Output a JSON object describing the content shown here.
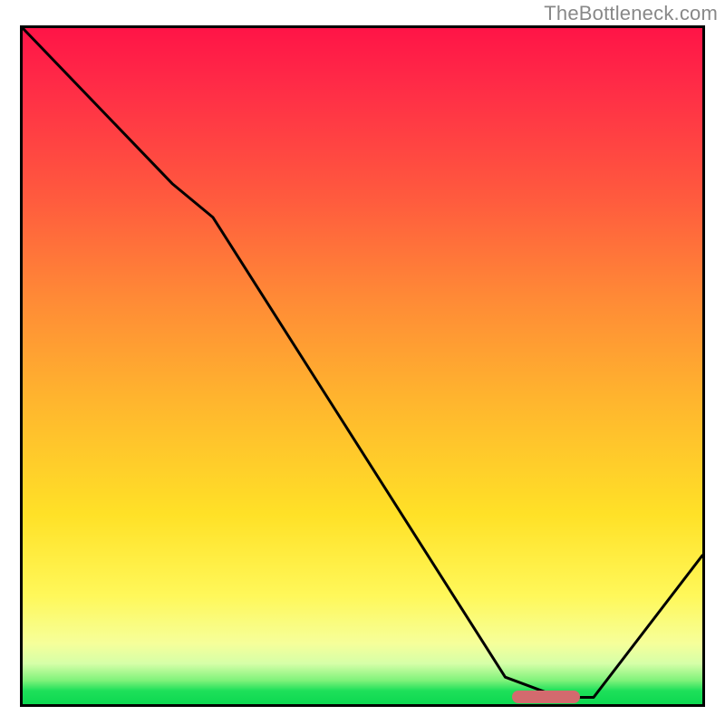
{
  "watermark": "TheBottleneck.com",
  "chart_data": {
    "type": "line",
    "title": "",
    "xlabel": "",
    "ylabel": "",
    "xlim": [
      0,
      100
    ],
    "ylim": [
      0,
      100
    ],
    "grid": false,
    "legend": false,
    "x_pct": [
      0,
      22,
      28,
      71,
      79,
      84,
      100
    ],
    "y_pct": [
      100,
      77,
      72,
      4,
      1,
      1,
      22
    ],
    "minimum_marker": {
      "x_start_pct": 72,
      "x_end_pct": 82,
      "y_pct": 1
    },
    "gradient_stops": [
      {
        "pct": 0,
        "color": "#ff1447"
      },
      {
        "pct": 8,
        "color": "#ff2a47"
      },
      {
        "pct": 25,
        "color": "#ff5a3e"
      },
      {
        "pct": 40,
        "color": "#ff8a36"
      },
      {
        "pct": 55,
        "color": "#ffb52e"
      },
      {
        "pct": 72,
        "color": "#ffe127"
      },
      {
        "pct": 84,
        "color": "#fff85a"
      },
      {
        "pct": 91,
        "color": "#f6ff9a"
      },
      {
        "pct": 94,
        "color": "#d6ffa8"
      },
      {
        "pct": 96.5,
        "color": "#7ff27a"
      },
      {
        "pct": 98,
        "color": "#1fe05a"
      },
      {
        "pct": 100,
        "color": "#0cd850"
      }
    ]
  }
}
